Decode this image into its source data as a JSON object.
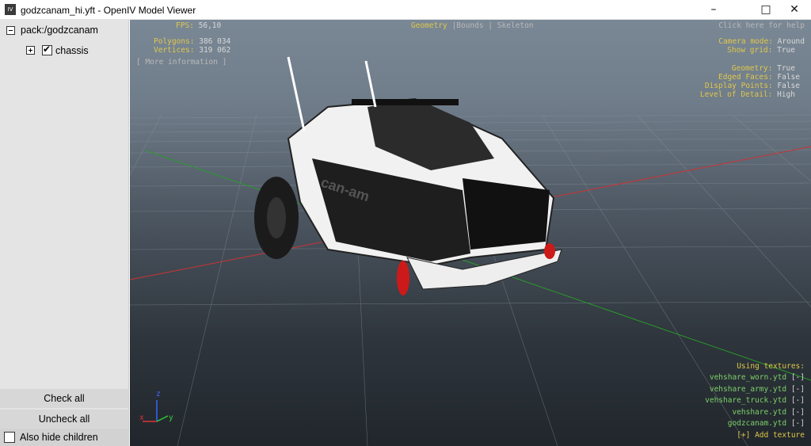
{
  "window": {
    "title": "godzcanam_hi.yft - OpenIV Model Viewer",
    "icon_text": "IV",
    "minimize_icon": "minimize-icon",
    "maximize_icon": "maximize-icon",
    "close_icon": "close-icon"
  },
  "tree": {
    "root_label": "pack:/godzcanam",
    "child_label": "chassis"
  },
  "sidebar": {
    "check_all": "Check all",
    "uncheck_all": "Uncheck all",
    "hide_children": "Also hide children"
  },
  "hud": {
    "fps_label": "FPS:",
    "fps_value": "56,10",
    "polygons_label": "Polygons:",
    "polygons_value": "386 034",
    "vertices_label": "Vertices:",
    "vertices_value": "319 062",
    "more_info": "[ More information ]",
    "mode_geometry": "Geometry",
    "mode_sep1": "|",
    "mode_bounds": "Bounds",
    "mode_sep2": "|",
    "mode_skeleton": "Skeleton",
    "help": "Click here for help",
    "camera_label": "Camera mode:",
    "camera_value": "Around",
    "grid_label": "Show grid:",
    "grid_value": "True",
    "geometry_label": "Geometry:",
    "geometry_value": "True",
    "edged_label": "Edged Faces:",
    "edged_value": "False",
    "points_label": "Display Points:",
    "points_value": "False",
    "lod_label": "Level of Detail:",
    "lod_value": "High"
  },
  "textures": {
    "header": "Using textures:",
    "items": [
      {
        "name": "vehshare_worn.ytd",
        "action": "[-]"
      },
      {
        "name": "vehshare_army.ytd",
        "action": "[-]"
      },
      {
        "name": "vehshare_truck.ytd",
        "action": "[-]"
      },
      {
        "name": "vehshare.ytd",
        "action": "[-]"
      },
      {
        "name": "godzcanam.ytd",
        "action": "[-]"
      }
    ],
    "add": "[+] Add texture"
  },
  "axes": {
    "x": "x",
    "y": "y",
    "z": "z"
  },
  "colors": {
    "hud_yellow": "#e0c74b",
    "hud_value": "#d8d8d8",
    "texture_green": "#7fd06a",
    "axis_x": "#d33",
    "axis_y": "#3c3",
    "axis_z": "#36f"
  }
}
